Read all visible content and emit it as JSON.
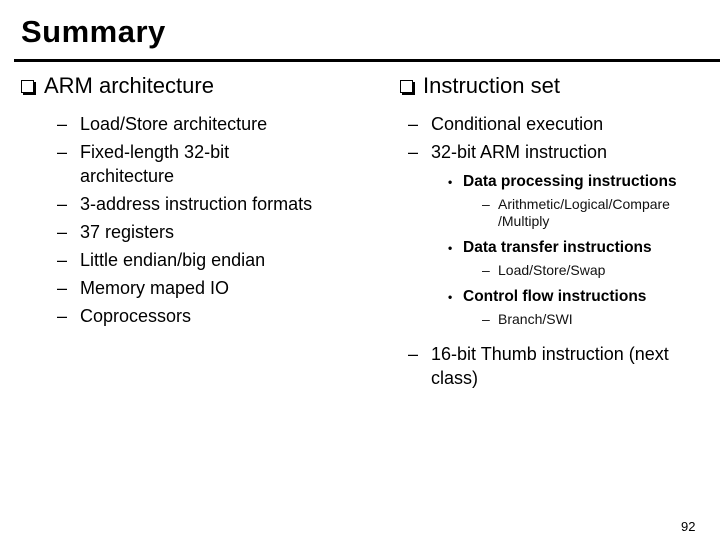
{
  "slide": {
    "title": "Summary",
    "page_number": "92",
    "left": {
      "heading": "ARM architecture",
      "items": [
        "Load/Store architecture",
        "Fixed-length 32-bit architecture",
        "3-address instruction formats",
        "37 registers",
        "Little endian/big endian",
        "Memory maped IO",
        "Coprocessors"
      ]
    },
    "right": {
      "heading": "Instruction set",
      "items": [
        {
          "label": "Conditional execution"
        },
        {
          "label": "32-bit ARM instruction",
          "subitems": [
            {
              "label": "Data processing instructions",
              "details": [
                "Arithmetic/Logical/Compare /Multiply"
              ]
            },
            {
              "label": "Data transfer instructions",
              "details": [
                "Load/Store/Swap"
              ]
            },
            {
              "label": "Control flow instructions",
              "details": [
                "Branch/SWI"
              ]
            }
          ]
        },
        {
          "label": "16-bit Thumb instruction (next class)"
        }
      ]
    },
    "bullets": {
      "dash": "–",
      "dot": "•"
    }
  }
}
